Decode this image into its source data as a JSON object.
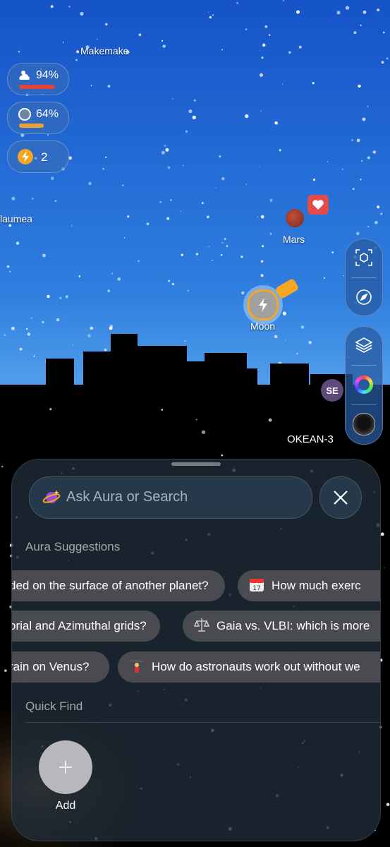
{
  "sky_labels": {
    "makemake": "Makemake",
    "haumea": "laumea",
    "mars": "Mars",
    "moon": "Moon",
    "satellite": "OKEAN-3",
    "se_badge": "SE"
  },
  "stats": {
    "weather": {
      "icon": "cloud-sun-icon",
      "value": "94%",
      "level": 0.94,
      "bar_color": "#e0443c"
    },
    "moon": {
      "icon": "moon-phase-icon",
      "value": "64%",
      "level": 0.64,
      "bar_color": "#f0a030"
    },
    "energy": {
      "icon": "lightning-icon",
      "value": "2"
    }
  },
  "tools": [
    "ar-view-icon",
    "compass-icon",
    "layers-icon",
    "color-wheel-icon",
    "brightness-icon"
  ],
  "search": {
    "placeholder": "Ask Aura or Search"
  },
  "suggestions": {
    "title": "Aura Suggestions",
    "rows": [
      [
        {
          "text": "ded on the surface of another planet?"
        },
        {
          "emoji": "calendar-icon",
          "text": "How much exerc"
        }
      ],
      [
        {
          "text": "orial and Azimuthal grids?"
        },
        {
          "emoji": "scales-icon",
          "text": "Gaia vs. VLBI: which is more"
        }
      ],
      [
        {
          "text": "rain on Venus?"
        },
        {
          "emoji": "weightlifter-icon",
          "text": "How do astronauts work out without we"
        }
      ]
    ]
  },
  "quick_find": {
    "title": "Quick Find",
    "add_label": "Add"
  },
  "colors": {
    "sky_top": "#1d5fd6",
    "sky_mid": "#3a8ee6",
    "sheet": "#1e2c38",
    "accent": "#f5a623"
  }
}
